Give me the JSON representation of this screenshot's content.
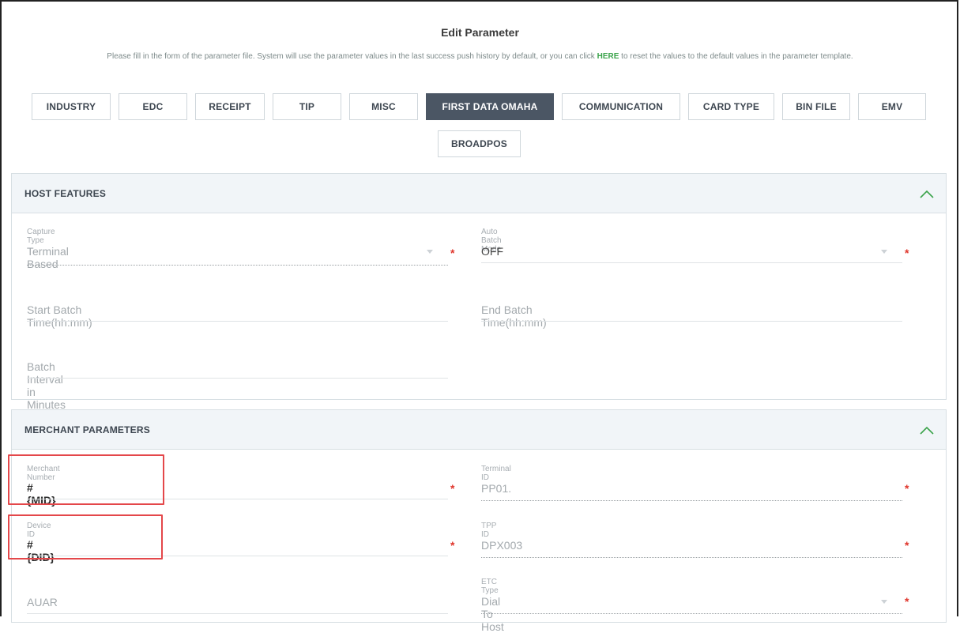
{
  "header": {
    "title": "Edit Parameter",
    "desc_before": "Please fill in the form of the parameter file. System will use the parameter values in the last success push history by default, or you can click",
    "desc_link": "HERE",
    "desc_after": "to reset the values to the default values in the parameter template."
  },
  "tabs": [
    "INDUSTRY",
    "EDC",
    "RECEIPT",
    "TIP",
    "MISC",
    "FIRST DATA OMAHA",
    "COMMUNICATION",
    "CARD TYPE",
    "BIN FILE",
    "EMV",
    "BROADPOS"
  ],
  "active_tab": "FIRST DATA OMAHA",
  "host_features": {
    "title": "HOST FEATURES",
    "capture_type": {
      "label": "Capture Type",
      "value": "Terminal Based",
      "required": "*"
    },
    "auto_batch_mode": {
      "label": "Auto Batch Mode",
      "value": "OFF",
      "required": "*"
    },
    "start_batch_time": {
      "placeholder": "Start Batch Time(hh:mm)"
    },
    "end_batch_time": {
      "placeholder": "End Batch Time(hh:mm)"
    },
    "batch_interval": {
      "placeholder": "Batch Interval in Minutes"
    }
  },
  "merchant_parameters": {
    "title": "MERCHANT PARAMETERS",
    "merchant_number": {
      "label": "Merchant Number",
      "value": "#{MID}",
      "required": "*"
    },
    "terminal_id": {
      "label": "Terminal ID",
      "value": "PP01.",
      "required": "*"
    },
    "device_id": {
      "label": "Device ID",
      "value": "#{DID}",
      "required": "*"
    },
    "tpp_id": {
      "label": "TPP ID",
      "value": "DPX003",
      "required": "*"
    },
    "auar": {
      "placeholder": "AUAR"
    },
    "etc_type": {
      "label": "ETC Type",
      "value": "Dial To Host",
      "required": "*"
    }
  },
  "colors": {
    "accent_active_tab": "#4b5664",
    "link_green": "#3aa34a",
    "required_red": "#e0362c",
    "highlight_red": "#e4474a",
    "chevron_green": "#3aa34a"
  },
  "icons": {
    "collapse": "chevron-up-icon",
    "dropdown": "caret-down-icon"
  }
}
